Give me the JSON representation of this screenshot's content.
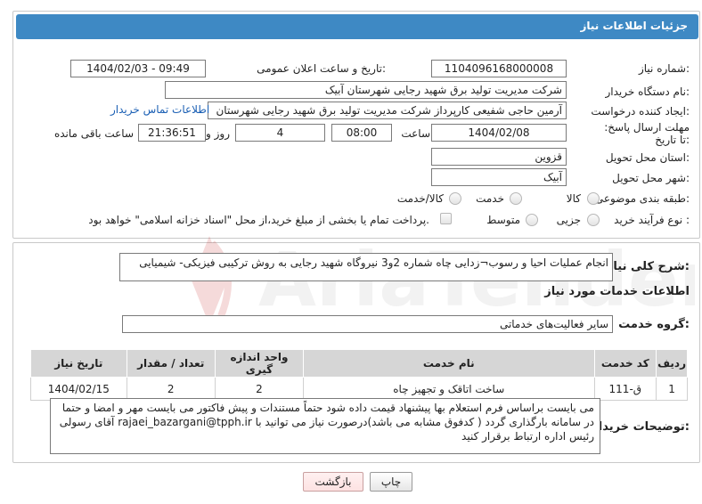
{
  "header": {
    "title": "جزئیات اطلاعات نیاز"
  },
  "labels": {
    "need_number": "شماره نیاز:",
    "announce_datetime": "تاریخ و ساعت اعلان عمومی:",
    "buyer_org": "نام دستگاه خریدار:",
    "requester": "ایجاد کننده درخواست:",
    "deadline": "مهلت ارسال پاسخ: تا تاریخ:",
    "time": "ساعت",
    "day_and": "روز و",
    "hours_left": "ساعت باقی مانده",
    "province": "استان محل تحویل:",
    "city": "شهر محل تحویل:",
    "category": "طبقه بندی موضوعی:",
    "purchase_type": "نوع فرآیند خرید :",
    "general_desc": "شرح کلی نیاز:",
    "services_info": "اطلاعات خدمات مورد نیاز",
    "service_group": "گروه خدمت:",
    "buyer_notes": "توضیحات خریدار:"
  },
  "fields": {
    "need_number": "1104096168000008",
    "announce_datetime": "1404/02/03 - 09:49",
    "buyer_org": "شرکت مدیریت تولید برق شهید رجایی شهرستان آبیک",
    "requester": "آرمین حاجی شفیعی کارپرداز شرکت مدیریت تولید برق شهید رجایی شهرستان",
    "deadline_date": "1404/02/08",
    "deadline_time": "08:00",
    "days": "4",
    "remaining": "21:36:51",
    "province": "قزوین",
    "city": "آبیک",
    "general_desc": "انجام عملیات احیا و رسوب¬زدایی چاه شماره 2و3 نیروگاه شهید رجایی به روش ترکیبی فیزیکی- شیمیایی",
    "service_group": "سایر فعالیت‌های خدماتی"
  },
  "links": {
    "buyer_contact": "اطلاعات تماس خریدار"
  },
  "category_options": [
    "کالا",
    "خدمت",
    "کالا/خدمت"
  ],
  "purchase_options": [
    "جزیی",
    "متوسط"
  ],
  "payment_note": "پرداخت تمام یا بخشی از مبلغ خرید،از محل \"اسناد خزانه اسلامی\" خواهد بود.",
  "table": {
    "headers": [
      "ردیف",
      "کد خدمت",
      "نام خدمت",
      "واحد اندازه گیری",
      "تعداد / مقدار",
      "تاریخ نیاز"
    ],
    "rows": [
      [
        "1",
        "ق-111",
        "ساخت اتاقک و تجهیز چاه",
        "2",
        "2",
        "1404/02/15"
      ]
    ]
  },
  "buyer_notes": "می بایست براساس فرم استعلام بها پیشنهاد قیمت داده شود حتماً مستندات و پیش فاکتور می بایست مهر و امضا و حتما در سامانه بارگذاری گردد ( کدفوق مشابه می باشد)درصورت نیاز می توانید با rajaei_bazargani@tpph.ir آقای رسولی رئیس اداره ارتباط برقرار کنید",
  "buttons": {
    "print": "چاپ",
    "back": "بازگشت"
  },
  "watermark": "AriaTender.neT",
  "colors": {
    "header": "#3e89c4",
    "link": "#1a5fb4",
    "back_button_bg": "#fde2e2"
  }
}
